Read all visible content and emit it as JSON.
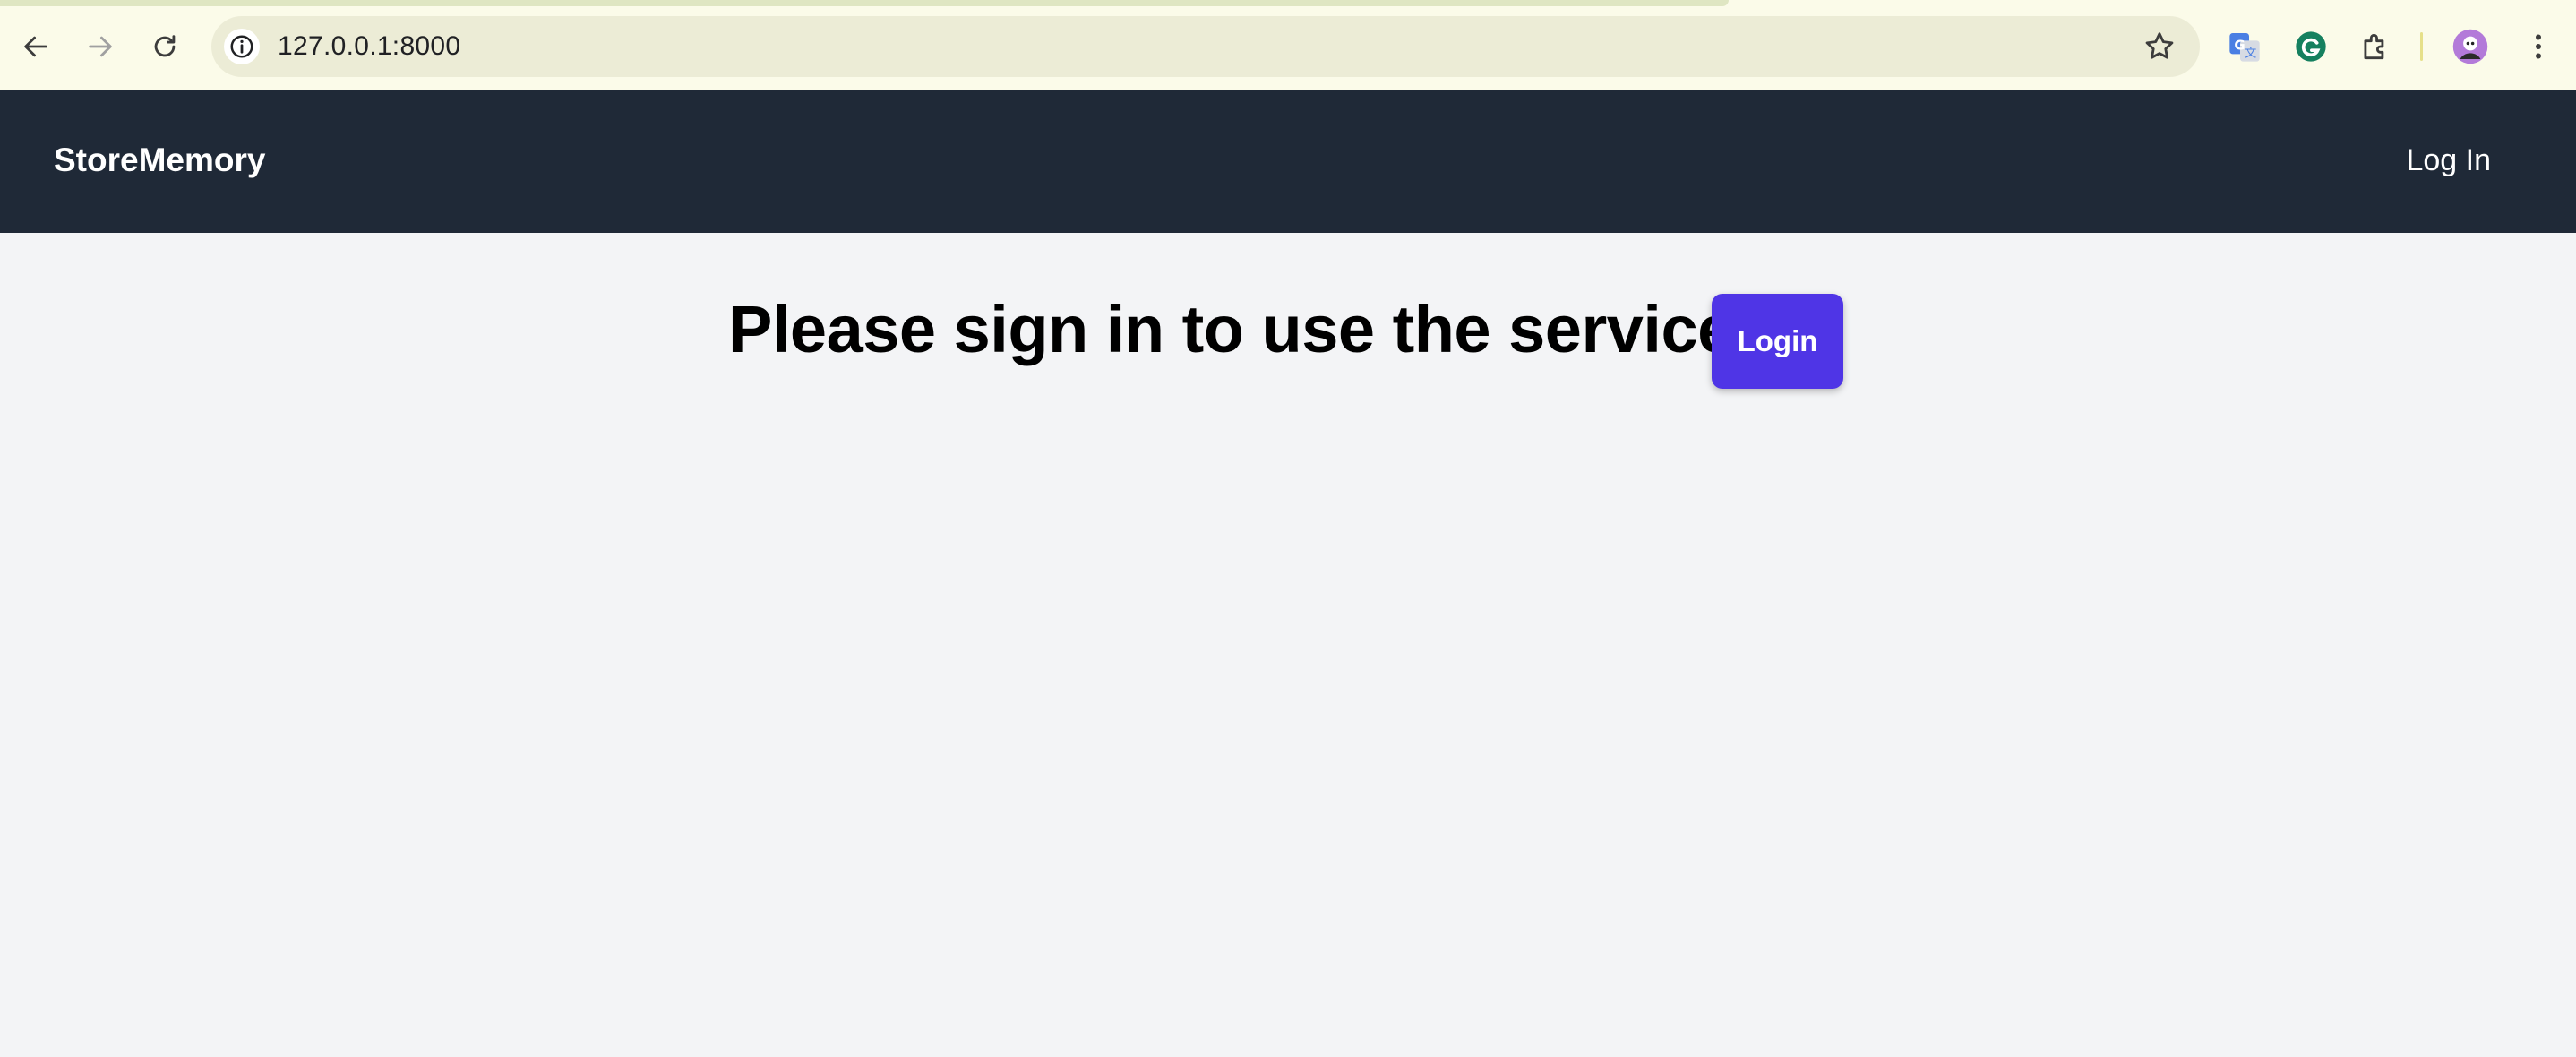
{
  "browser": {
    "url": "127.0.0.1:8000",
    "icons": [
      "back-icon",
      "forward-icon",
      "reload-icon",
      "info-icon",
      "star-icon",
      "translate-extension-icon",
      "grammarly-extension-icon",
      "puzzle-extensions-icon",
      "profile-avatar",
      "kebab-menu-icon"
    ]
  },
  "navbar": {
    "brand": "StoreMemory",
    "login_link": "Log In",
    "background": "#1f2937"
  },
  "main": {
    "headline": "Please sign in to use the service",
    "login_button": "Login",
    "button_color": "#4f35e6",
    "background": "#f3f4f6"
  }
}
